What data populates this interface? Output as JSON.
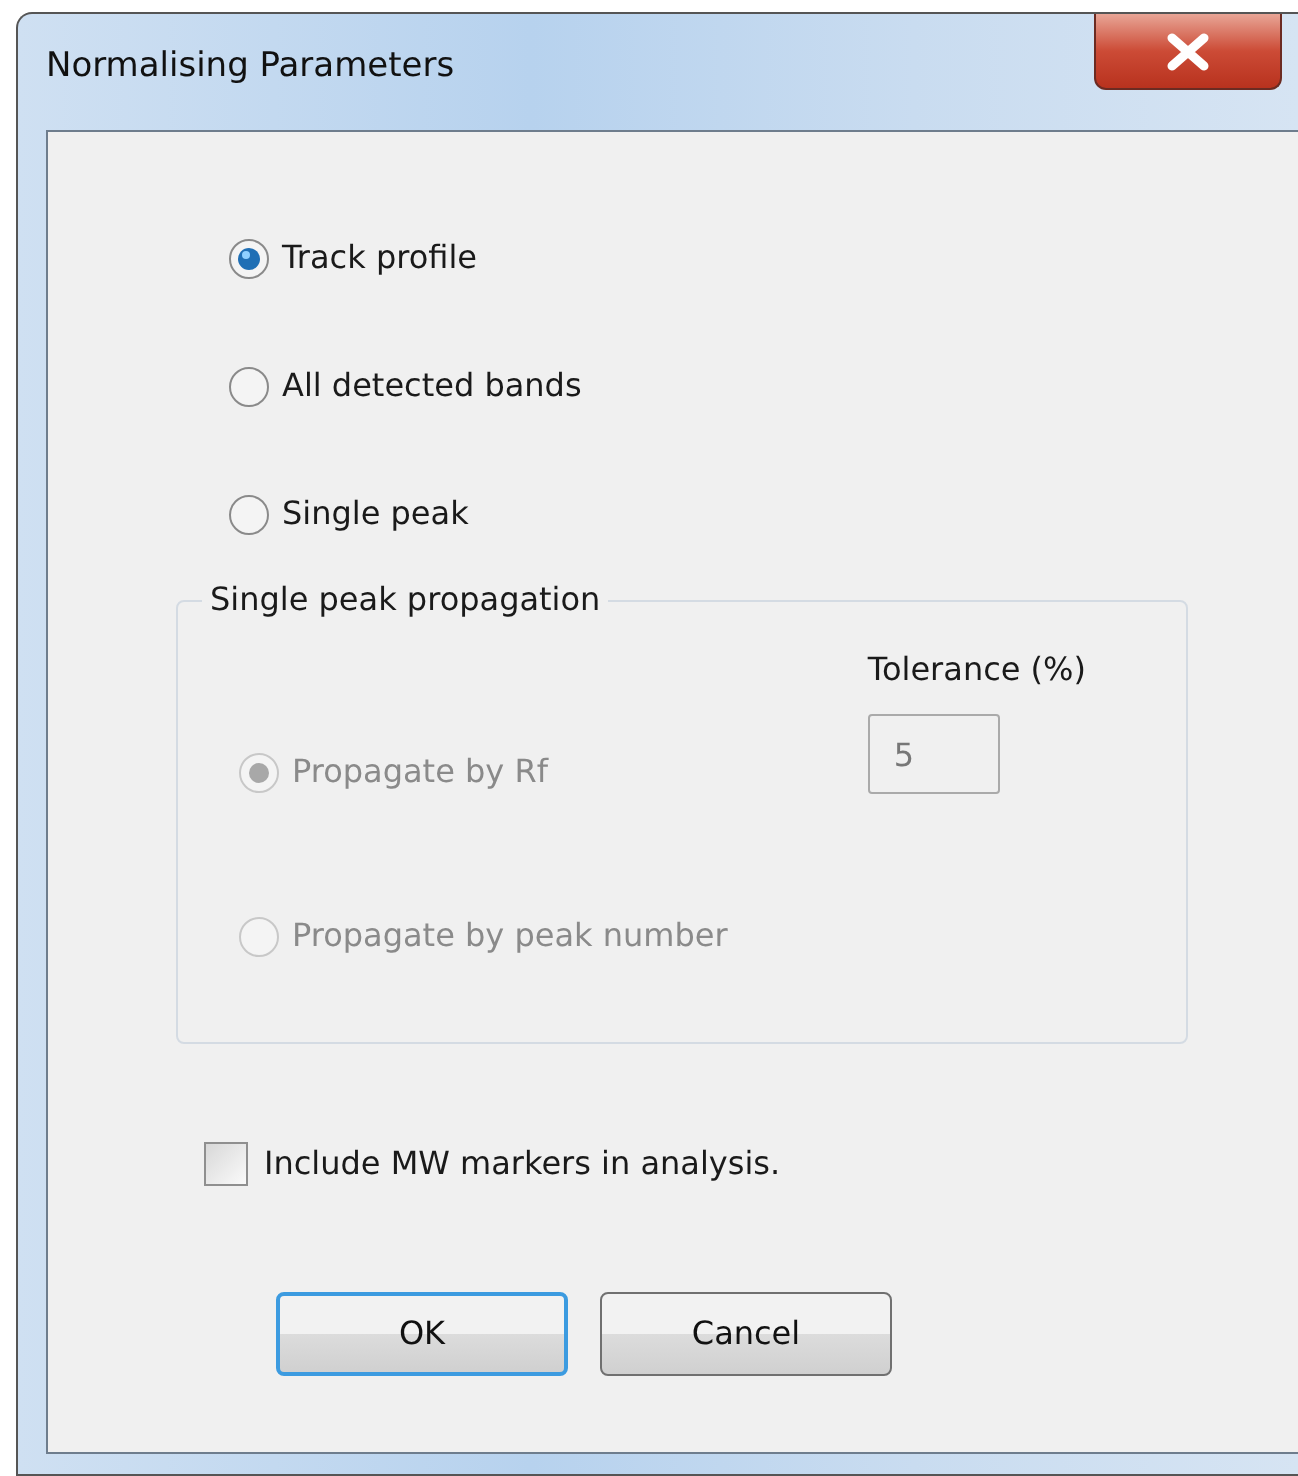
{
  "window": {
    "title": "Normalising Parameters"
  },
  "modes": [
    {
      "label": "Track profile",
      "selected": true
    },
    {
      "label": "All detected bands",
      "selected": false
    },
    {
      "label": "Single peak",
      "selected": false
    }
  ],
  "propagation": {
    "legend": "Single peak propagation",
    "tolerance_label": "Tolerance (%)",
    "tolerance_value": "5",
    "disabled": true,
    "options": [
      {
        "label": "Propagate by Rf",
        "selected": true
      },
      {
        "label": "Propagate by peak number",
        "selected": false
      }
    ]
  },
  "include_markers": {
    "label": "Include MW markers in analysis.",
    "checked": false
  },
  "buttons": [
    {
      "label": "OK",
      "default": true
    },
    {
      "label": "Cancel",
      "default": false
    }
  ]
}
